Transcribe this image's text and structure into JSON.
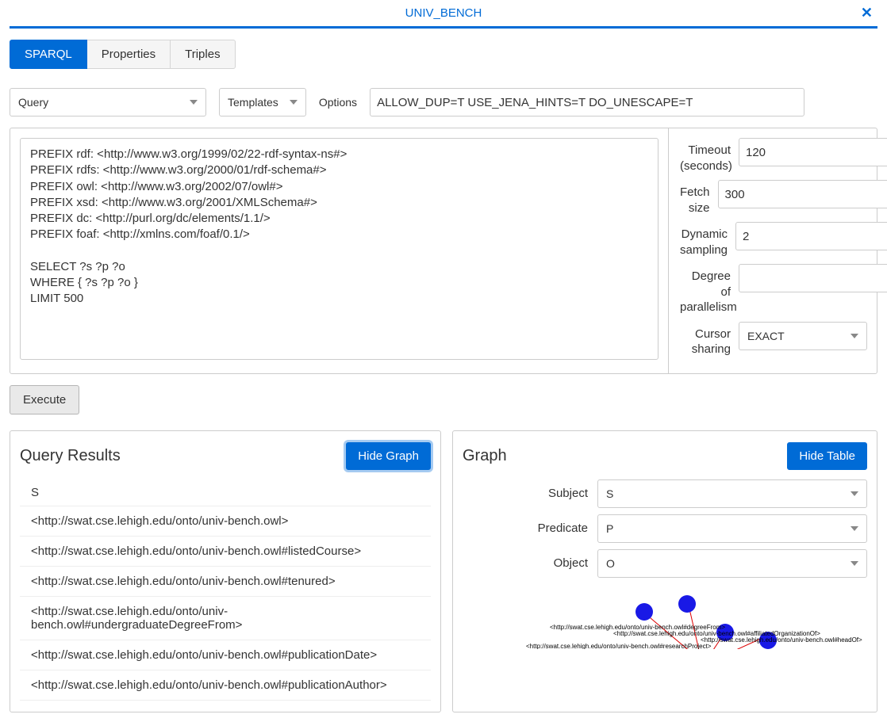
{
  "header": {
    "title": "UNIV_BENCH"
  },
  "tabs": {
    "sparql": "SPARQL",
    "properties": "Properties",
    "triples": "Triples"
  },
  "controls": {
    "query_label": "Query",
    "templates_label": "Templates",
    "options_label": "Options",
    "options_value": "ALLOW_DUP=T USE_JENA_HINTS=T DO_UNESCAPE=T"
  },
  "editor_text": "PREFIX rdf: <http://www.w3.org/1999/02/22-rdf-syntax-ns#>\nPREFIX rdfs: <http://www.w3.org/2000/01/rdf-schema#>\nPREFIX owl: <http://www.w3.org/2002/07/owl#>\nPREFIX xsd: <http://www.w3.org/2001/XMLSchema#>\nPREFIX dc: <http://purl.org/dc/elements/1.1/>\nPREFIX foaf: <http://xmlns.com/foaf/0.1/>\n\nSELECT ?s ?p ?o\nWHERE { ?s ?p ?o }\nLIMIT 500",
  "side": {
    "timeout_label": "Timeout (seconds)",
    "timeout_value": "120",
    "fetch_label": "Fetch size",
    "fetch_value": "300",
    "dynamic_label": "Dynamic sampling",
    "dynamic_value": "2",
    "parallel_label": "Degree of parallelism",
    "parallel_value": "",
    "cursor_label": "Cursor sharing",
    "cursor_value": "EXACT"
  },
  "execute_label": "Execute",
  "results": {
    "title": "Query Results",
    "hide_graph": "Hide Graph",
    "col_header": "S",
    "rows": [
      "<http://swat.cse.lehigh.edu/onto/univ-bench.owl>",
      "<http://swat.cse.lehigh.edu/onto/univ-bench.owl#listedCourse>",
      "<http://swat.cse.lehigh.edu/onto/univ-bench.owl#tenured>",
      "<http://swat.cse.lehigh.edu/onto/univ-bench.owl#undergraduateDegreeFrom>",
      "<http://swat.cse.lehigh.edu/onto/univ-bench.owl#publicationDate>",
      "<http://swat.cse.lehigh.edu/onto/univ-bench.owl#publicationAuthor>"
    ]
  },
  "graph": {
    "title": "Graph",
    "hide_table": "Hide Table",
    "subject_label": "Subject",
    "subject_value": "S",
    "predicate_label": "Predicate",
    "predicate_value": "P",
    "object_label": "Object",
    "object_value": "O",
    "node_labels": {
      "a": "<http://swat.cse.lehigh.edu/onto/univ-bench.owl#degreeFrom>",
      "b": "<http://swat.cse.lehigh.edu/onto/univ-bench.owl#affiliatedOrganizationOf>",
      "c": "<http://swat.cse.lehigh.edu/onto/univ-bench.owl#headOf>",
      "d": "<http://swat.cse.lehigh.edu/onto/univ-bench.owl#researchProject>"
    }
  }
}
